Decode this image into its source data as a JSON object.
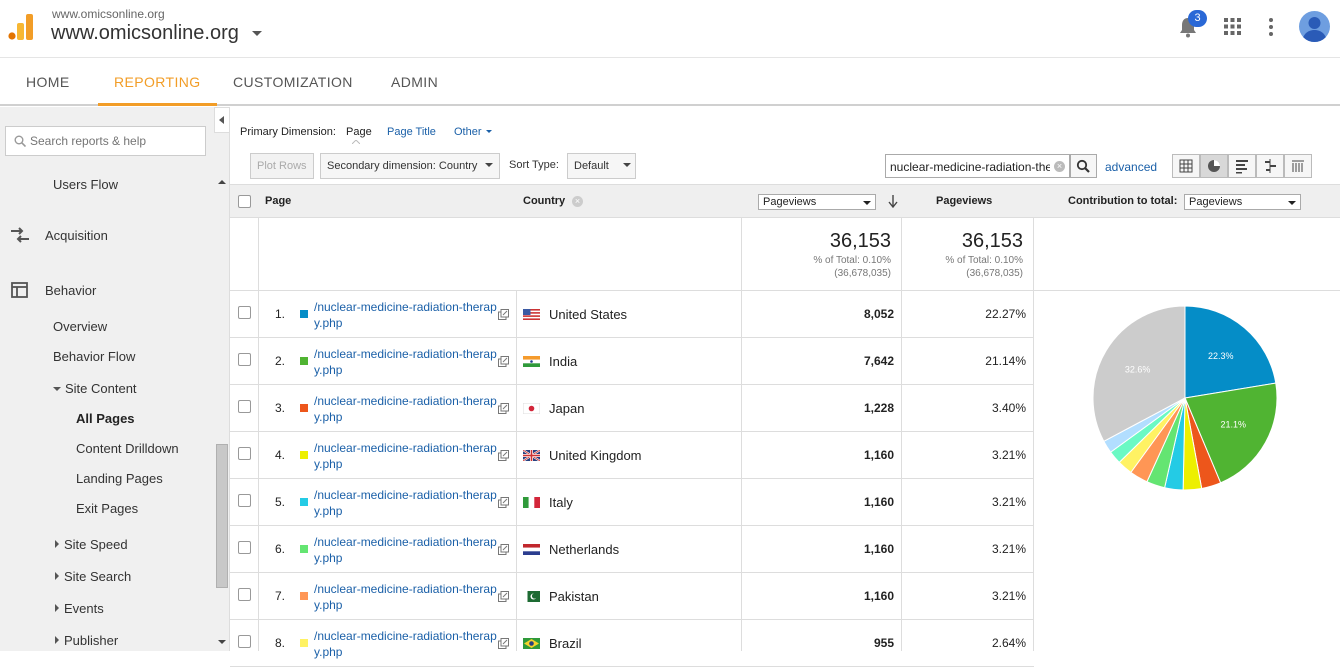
{
  "header": {
    "site_small": "www.omicsonline.org",
    "site_big": "www.omicsonline.org",
    "notification_count": "3"
  },
  "nav": {
    "tabs": [
      {
        "label": "HOME",
        "active": false
      },
      {
        "label": "REPORTING",
        "active": true
      },
      {
        "label": "CUSTOMIZATION",
        "active": false
      },
      {
        "label": "ADMIN",
        "active": false
      }
    ]
  },
  "sidebar": {
    "search_placeholder": "Search reports & help",
    "items": {
      "users_flow": "Users Flow",
      "acquisition": "Acquisition",
      "behavior": "Behavior",
      "overview": "Overview",
      "behavior_flow": "Behavior Flow",
      "site_content": "Site Content",
      "all_pages": "All Pages",
      "content_drilldown": "Content Drilldown",
      "landing_pages": "Landing Pages",
      "exit_pages": "Exit Pages",
      "site_speed": "Site Speed",
      "site_search": "Site Search",
      "events": "Events",
      "publisher": "Publisher"
    }
  },
  "report": {
    "primary_dimension_label": "Primary Dimension:",
    "primary_page": "Page",
    "primary_page_title": "Page Title",
    "primary_other": "Other",
    "plot_rows": "Plot Rows",
    "secondary_dimension": "Secondary dimension: Country",
    "sort_type_label": "Sort Type:",
    "sort_type_value": "Default",
    "filter_value": "nuclear-medicine-radiation-therapy",
    "advanced": "advanced",
    "columns": {
      "page": "Page",
      "country": "Country",
      "metric_select": "Pageviews",
      "pageviews": "Pageviews",
      "contribution_label": "Contribution to total:",
      "contribution_select": "Pageviews"
    },
    "totals": {
      "value_1": "36,153",
      "pct_1": "% of Total: 0.10%",
      "base_1": "(36,678,035)",
      "value_2": "36,153",
      "pct_2": "% of Total: 0.10%",
      "base_2": "(36,678,035)"
    },
    "rows": [
      {
        "n": "1.",
        "page": "/nuclear-medicine-radiation-therapy.php",
        "country": "United States",
        "pageviews": "8,052",
        "pct": "22.27%",
        "color": "#058dc7",
        "flag": "us"
      },
      {
        "n": "2.",
        "page": "/nuclear-medicine-radiation-therapy.php",
        "country": "India",
        "pageviews": "7,642",
        "pct": "21.14%",
        "color": "#50b432",
        "flag": "in"
      },
      {
        "n": "3.",
        "page": "/nuclear-medicine-radiation-therapy.php",
        "country": "Japan",
        "pageviews": "1,228",
        "pct": "3.40%",
        "color": "#ed561b",
        "flag": "jp"
      },
      {
        "n": "4.",
        "page": "/nuclear-medicine-radiation-therapy.php",
        "country": "United Kingdom",
        "pageviews": "1,160",
        "pct": "3.21%",
        "color": "#edef00",
        "flag": "gb"
      },
      {
        "n": "5.",
        "page": "/nuclear-medicine-radiation-therapy.php",
        "country": "Italy",
        "pageviews": "1,160",
        "pct": "3.21%",
        "color": "#24cbe5",
        "flag": "it"
      },
      {
        "n": "6.",
        "page": "/nuclear-medicine-radiation-therapy.php",
        "country": "Netherlands",
        "pageviews": "1,160",
        "pct": "3.21%",
        "color": "#64e572",
        "flag": "nl"
      },
      {
        "n": "7.",
        "page": "/nuclear-medicine-radiation-therapy.php",
        "country": "Pakistan",
        "pageviews": "1,160",
        "pct": "3.21%",
        "color": "#ff9655",
        "flag": "pk"
      },
      {
        "n": "8.",
        "page": "/nuclear-medicine-radiation-therapy.php",
        "country": "Brazil",
        "pageviews": "955",
        "pct": "2.64%",
        "color": "#fff263",
        "flag": "br"
      }
    ]
  },
  "chart_data": {
    "type": "pie",
    "slices": [
      {
        "label": "22.3%",
        "value": 22.27,
        "color": "#058dc7",
        "show_label": true
      },
      {
        "label": "21.1%",
        "value": 21.14,
        "color": "#50b432",
        "show_label": true
      },
      {
        "label": "",
        "value": 3.4,
        "color": "#ed561b",
        "show_label": false
      },
      {
        "label": "",
        "value": 3.21,
        "color": "#edef00",
        "show_label": false
      },
      {
        "label": "",
        "value": 3.21,
        "color": "#24cbe5",
        "show_label": false
      },
      {
        "label": "",
        "value": 3.21,
        "color": "#64e572",
        "show_label": false
      },
      {
        "label": "",
        "value": 3.21,
        "color": "#ff9655",
        "show_label": false
      },
      {
        "label": "",
        "value": 2.64,
        "color": "#fff263",
        "show_label": false
      },
      {
        "label": "",
        "value": 2.3,
        "color": "#6af9c4",
        "show_label": false
      },
      {
        "label": "",
        "value": 2.2,
        "color": "#b2deff",
        "show_label": false
      },
      {
        "label": "32.6%",
        "value": 32.6,
        "color": "#cccccc",
        "show_label": true
      }
    ]
  }
}
